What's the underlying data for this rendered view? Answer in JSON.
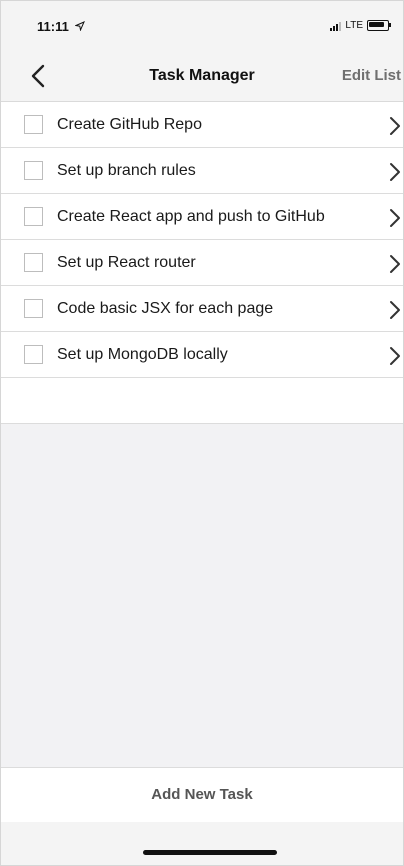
{
  "status_bar": {
    "time": "11:11",
    "network": "LTE",
    "icons": [
      "location-arrow-icon",
      "signal-icon",
      "battery-icon"
    ]
  },
  "nav": {
    "back_icon": "chevron-left-icon",
    "title": "Task Manager",
    "edit_label": "Edit List"
  },
  "tasks": [
    {
      "label": "Create GitHub Repo",
      "checked": false
    },
    {
      "label": "Set up branch rules",
      "checked": false
    },
    {
      "label": "Create React app and push to GitHub",
      "checked": false
    },
    {
      "label": "Set up React router",
      "checked": false
    },
    {
      "label": "Code basic JSX for each page",
      "checked": false
    },
    {
      "label": "Set up MongoDB locally",
      "checked": false
    }
  ],
  "footer": {
    "add_task_label": "Add New Task"
  },
  "colors": {
    "bar_background": "#f4f4f4",
    "list_background": "#f2f2f4",
    "divider": "#dcdcdc",
    "edit_text": "#6f6f6f"
  }
}
